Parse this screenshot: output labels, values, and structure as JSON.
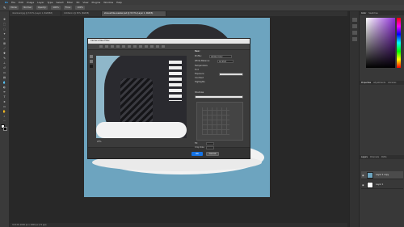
{
  "menu": [
    "Ps",
    "File",
    "Edit",
    "Image",
    "Layer",
    "Type",
    "Select",
    "Filter",
    "3D",
    "View",
    "Plugins",
    "Window",
    "Help"
  ],
  "options": [
    "Mode:",
    "Normal",
    "Opacity:",
    "100%",
    "Flow:",
    "100%"
  ],
  "tabs": [
    {
      "label": "download.jpg @ 33.3% (Layer 1, RGB/8#)",
      "active": false
    },
    {
      "label": "Untitled-1 @ 50% (RGB/8)",
      "active": false
    },
    {
      "label": "shoe-white-sneaker.psd @ 33.3% (Layer 1, RGB/8)",
      "active": true
    }
  ],
  "dialog": {
    "title": "Camera Raw Filter",
    "preview_zoom": "25%",
    "basic_label": "Basic",
    "profile_label": "Profile:",
    "profile_value": "Adobe Color",
    "white_balance_label": "White Balance:",
    "white_balance_value": "As Shot",
    "temperature_label": "Temperature",
    "tint_label": "Tint",
    "exposure_label": "Exposure",
    "contrast_label": "Contrast",
    "highlights_label": "Highlights",
    "shadows_label": "Shadows",
    "fill_label": "Fill",
    "crop_label": "Crop Size",
    "ok_label": "OK",
    "cancel_label": "Cancel"
  },
  "right_panel": {
    "color_tabs": [
      "Color",
      "Swatches"
    ],
    "properties_tabs": [
      "Properties",
      "Adjustments",
      "Libraries"
    ],
    "layers_tabs": [
      "Layers",
      "Channels",
      "Paths"
    ],
    "layers": [
      {
        "name": "Layer 1 copy",
        "selected": true
      },
      {
        "name": "Layer 1",
        "selected": false
      }
    ]
  },
  "status": "33.33%   2000 px x 2000 px (72 ppi)",
  "colors": {
    "canvas": "#6da4bf",
    "accent": "#1473e6"
  }
}
